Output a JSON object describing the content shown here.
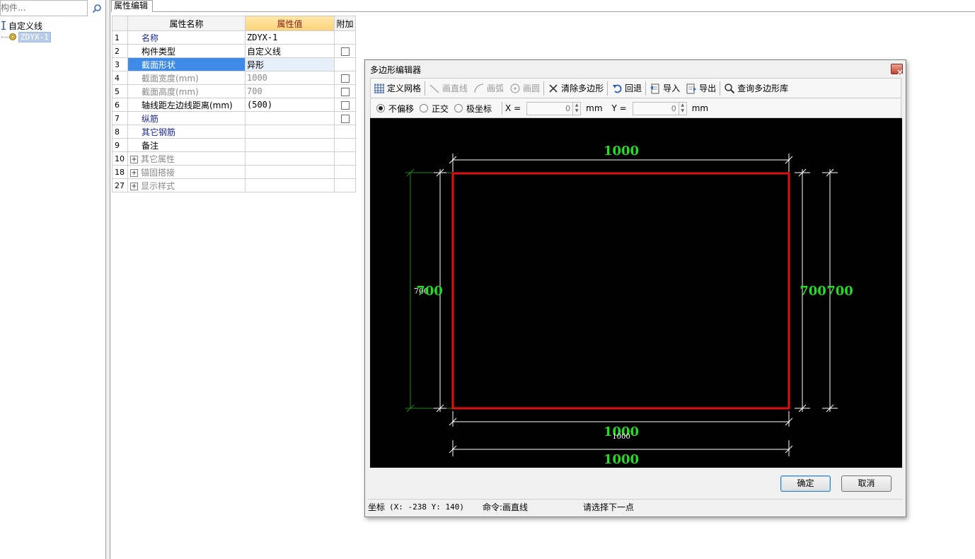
{
  "search": {
    "placeholder": "构件..."
  },
  "tree": {
    "root_label": "自定义线",
    "child_label": "ZDYX-1"
  },
  "prop_tab": {
    "label": "属性编辑"
  },
  "table": {
    "headers": {
      "name": "属性名称",
      "value": "属性值",
      "extra": "附加"
    },
    "rows": [
      {
        "num": "1",
        "name": "名称",
        "value": "ZDYX-1",
        "has_checkbox": false
      },
      {
        "num": "2",
        "name": "构件类型",
        "value": "自定义线",
        "has_checkbox": true
      },
      {
        "num": "3",
        "name": "截面形状",
        "value": "异形",
        "has_checkbox": false
      },
      {
        "num": "4",
        "name": "截面宽度(mm)",
        "value": "1000",
        "has_checkbox": true
      },
      {
        "num": "5",
        "name": "截面高度(mm)",
        "value": "700",
        "has_checkbox": true
      },
      {
        "num": "6",
        "name": "轴线距左边线距离(mm)",
        "value": "(500)",
        "has_checkbox": true
      },
      {
        "num": "7",
        "name": "纵筋",
        "value": "",
        "has_checkbox": true
      },
      {
        "num": "8",
        "name": "其它钢筋",
        "value": "",
        "has_checkbox": false
      },
      {
        "num": "9",
        "name": "备注",
        "value": "",
        "has_checkbox": false
      },
      {
        "num": "10",
        "name": "其它属性",
        "value": "",
        "has_checkbox": false
      },
      {
        "num": "18",
        "name": "锚固搭接",
        "value": "",
        "has_checkbox": false
      },
      {
        "num": "27",
        "name": "显示样式",
        "value": "",
        "has_checkbox": false
      }
    ]
  },
  "dialog": {
    "title": "多边形编辑器",
    "close_glyph": "×",
    "toolbar": {
      "define_grid": "定义网格",
      "draw_line": "画直线",
      "draw_arc": "画弧",
      "draw_circle": "画圆",
      "clear_polygon": "清除多边形",
      "undo": "回退",
      "import": "导入",
      "export": "导出",
      "query_library": "查询多边形库"
    },
    "offset": {
      "no_offset": "不偏移",
      "orthogonal": "正交",
      "polar": "极坐标",
      "x_label": "X =",
      "x_value": "0",
      "x_unit": "mm",
      "y_label": "Y =",
      "y_value": "0",
      "y_unit": "mm",
      "spin_up": "▲",
      "spin_down": "▼"
    },
    "drawing": {
      "colors": {
        "background": "#000000",
        "shape": "#e01010",
        "dim_green": "#22dd22",
        "dim_white": "#ffffff",
        "guide_green": "#1a8a1a"
      },
      "top_dim": "1000",
      "bottom_dim_1": "1000",
      "bottom_dim_1_small": "1000",
      "bottom_dim_2": "1000",
      "left_dim": "700",
      "left_dim_small": "700",
      "right_dim_1": "700",
      "right_dim_2": "700"
    },
    "ok_label": "确定",
    "cancel_label": "取消",
    "status": {
      "coord_label": "坐标",
      "coord_value": "(X: -238 Y: 140)",
      "command_label": "命令:",
      "command_value": "画直线",
      "prompt": "请选择下一点"
    }
  }
}
